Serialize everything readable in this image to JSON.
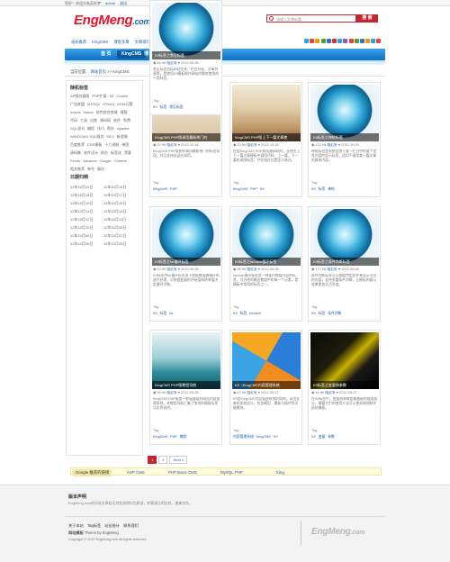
{
  "topbar": {
    "welcome": "您好！欢迎光临英轩梦",
    "user": "admin",
    "logout": "退出"
  },
  "brand": {
    "name": "EngMeng",
    "tld": ".com",
    "tagline": "专注技术，专注程序开发，专注网站建设"
  },
  "search": {
    "placeholder": "请输入文章标题...",
    "button": "搜 索"
  },
  "topnav": [
    "站长推荐",
    "KingCMS",
    "博客文章",
    "文章排行",
    "Tag标签",
    "K9模板"
  ],
  "social_colors": [
    "#2ba4e3",
    "#e8423b",
    "#f39800",
    "#52a02c",
    "#3a6fbf",
    "#d9312b",
    "#2ba4e3",
    "#8b5bb5",
    "#e8423b",
    "#52a02c",
    "#3a6fbf",
    "#f39800",
    "#2ba4e3",
    "#e8423b"
  ],
  "mainnav": {
    "items": [
      "首 页",
      "KingCMS",
      "博 客"
    ],
    "active": 1
  },
  "breadcrumb": {
    "prefix": "当前位置：",
    "home": "网站首页",
    "current": "KingCMS"
  },
  "sidebar": {
    "tags_title": "随机标签",
    "tags": [
      "AP服务器版",
      "PHP扩展",
      "K8",
      "Cookie",
      "广告联盟",
      "MSSQL",
      "HTML5",
      "DOM元素",
      "scripts",
      "iframe",
      "软件综合商城",
      "模版",
      "代码",
      "工具",
      "出售",
      "源码网",
      "软件",
      "免费",
      "SQL语句",
      "编程",
      "技巧",
      "帮办",
      "Apache",
      "",
      "",
      "WINDOWS SQL服务",
      "SEO",
      "新浪微",
      "百度推荐",
      "CSS模板",
      "十六进制",
      "帝国",
      "源码集",
      "软件设计",
      "前台",
      "标签化",
      "黑客",
      "Feeds",
      "Advance",
      "Google",
      "Chrome",
      "相关推荐",
      "",
      "单令",
      "备份"
    ],
    "dates_title": "日期归档",
    "dates": [
      "12年10月20日",
      "12年10月19日",
      "12年10月18日",
      "12年10月17日",
      "12年10月16日",
      "12年10月15日",
      "12年10月14日",
      "12年10月13日",
      "12年10月12日",
      "12年10月11日",
      "12年10月10日",
      "12年10月09日",
      "12年10月08日",
      "12年10月07日",
      "12年10月06日",
      "12年10月05日"
    ]
  },
  "cards": [
    {
      "caption": "KingCMS PHP版调用最新热门的",
      "views": "23 Hit",
      "author": "临近轩",
      "date": "2012-10-18",
      "desc": "KingCMS PHP版制作调用最新热门的标签实现，并且支持自适应调用。",
      "tag_label": "Tag：",
      "tags": [
        "KingCMS",
        "PHP"
      ]
    },
    {
      "caption": "KingCMS PHP版上下一篇文章使",
      "views": "23 Hit",
      "author": "临近轩",
      "date": "2012-10-18",
      "desc": "在用KingCMS PHP版搭建网站时，支持在上下一篇文章模板中调用代码：上一篇，下一篇的调用标签，并在相应位置定义格式。",
      "tag_label": "Tag：",
      "tags": [
        "KingCMS",
        "PHP",
        "K9"
      ]
    },
    {
      "caption": "K9标签之神帖标签",
      "views": "122 Hit",
      "author": "临近轩",
      "date": "2012-10-09",
      "desc": "神帖标签是系统设置下某一栏目中的某个信息内容的显示标签，适用于调用某一篇文章的具体内容。",
      "tag_label": "Tag：",
      "tags": [
        "K9",
        "标签",
        "神帖"
      ]
    },
    {
      "caption": "K9标签之for循环标签",
      "views": "43 Hit",
      "author": "临近轩",
      "date": "2012-09-28",
      "desc": "K9标签中for循环标签用于依据数值做循环的迭代处理，可依据变量的开始值和结束值决定循环次数。",
      "tag_label": "Tag：",
      "tags": [
        "K9",
        "标签",
        "for"
      ]
    },
    {
      "caption": "K9标签之foreach循环标签",
      "views": "38 Hit",
      "author": "临近轩",
      "date": "2012-09-28",
      "desc": "foreach循环标签是一种迭代数组内容的标签，可方便的输出数组中的每一个元素，是模板中常用的标签之一。",
      "tag_label": "Tag：",
      "tags": [
        "K9",
        "标签",
        "foreach"
      ]
    },
    {
      "caption": "K9标签之条件判断标签",
      "views": "177 Hit",
      "author": "临近轩",
      "date": "2012-09-28",
      "desc": "条件判断标签可以根据特定条件来显示不同的内容，支持多重条件判断，让模板的展示效果更加灵活多变。",
      "tag_label": "Tag：",
      "tags": [
        "K9",
        "标签",
        "条件判断"
      ]
    },
    {
      "caption": "KingCMS PHP版教程导航",
      "views": "35 Hit",
      "author": "临近轩",
      "date": "2012-09-28",
      "desc": "KingCMS PHP版是一款轻量级的网站内容管理系统，本教程导航汇集了常用的模板标签与实例说明。",
      "tag_label": "Tag：",
      "tags": [
        "KingCMS",
        "PHP",
        "教程"
      ]
    },
    {
      "caption": "K9（KingCMS内容管理系统",
      "views": "42 Hit",
      "author": "临近轩",
      "date": "2012-09-27",
      "desc": "K9是KingCMS内容管理系统的简称，采用全新的架构设计，包含模型、模板与插件等功能模块。",
      "tag_label": "Tag：",
      "tags": [
        "内容管理系统",
        "KingCMS",
        "K9"
      ]
    },
    {
      "caption": "K9标签之变量和参数",
      "views": "44 Hit",
      "author": "临近轩",
      "date": "2012-09-27",
      "desc": "在K9标签中，变量和参数是最基础的组成部分，掌握它们的使用方法可以更高效地制作网站模板。",
      "tag_label": "Tag：",
      "tags": [
        "K9",
        "变量",
        "参数"
      ]
    },
    {
      "caption": "K9标签之常见标签",
      "views": "54 Hit",
      "author": "临近轩",
      "date": "2012-09-26",
      "desc": "常见标签包括网站信息、栏目列表、文章列表等，是使用K9模板制作网站时最常使用的一类标签。",
      "tag_label": "Tag：",
      "tags": [
        "K9",
        "标签",
        "常见标签"
      ]
    }
  ],
  "pagination": {
    "pages": [
      "1",
      "2"
    ],
    "current": "1",
    "next": "Next »"
  },
  "friendlinks": {
    "label": "Google 推荐的链接",
    "links": [
      "ASP CMS",
      "PHP Basic CMS",
      "MySQL PHP",
      "King"
    ]
  },
  "footer": {
    "title": "版本声明",
    "desc": "EngMeng.com的所有文章若无特别说明均为原创，转载请注明出处，谢谢合作。",
    "links": [
      "关于本站",
      "Tag标签",
      "站长统计",
      "联系我们"
    ],
    "theme_label": "网站模板",
    "theme_text": "Theme by EngMeng",
    "copyright": "Copyright © 2012 EngMeng.com All rights reserved.",
    "logo_name": "EngMeng",
    "logo_tld": ".com"
  }
}
